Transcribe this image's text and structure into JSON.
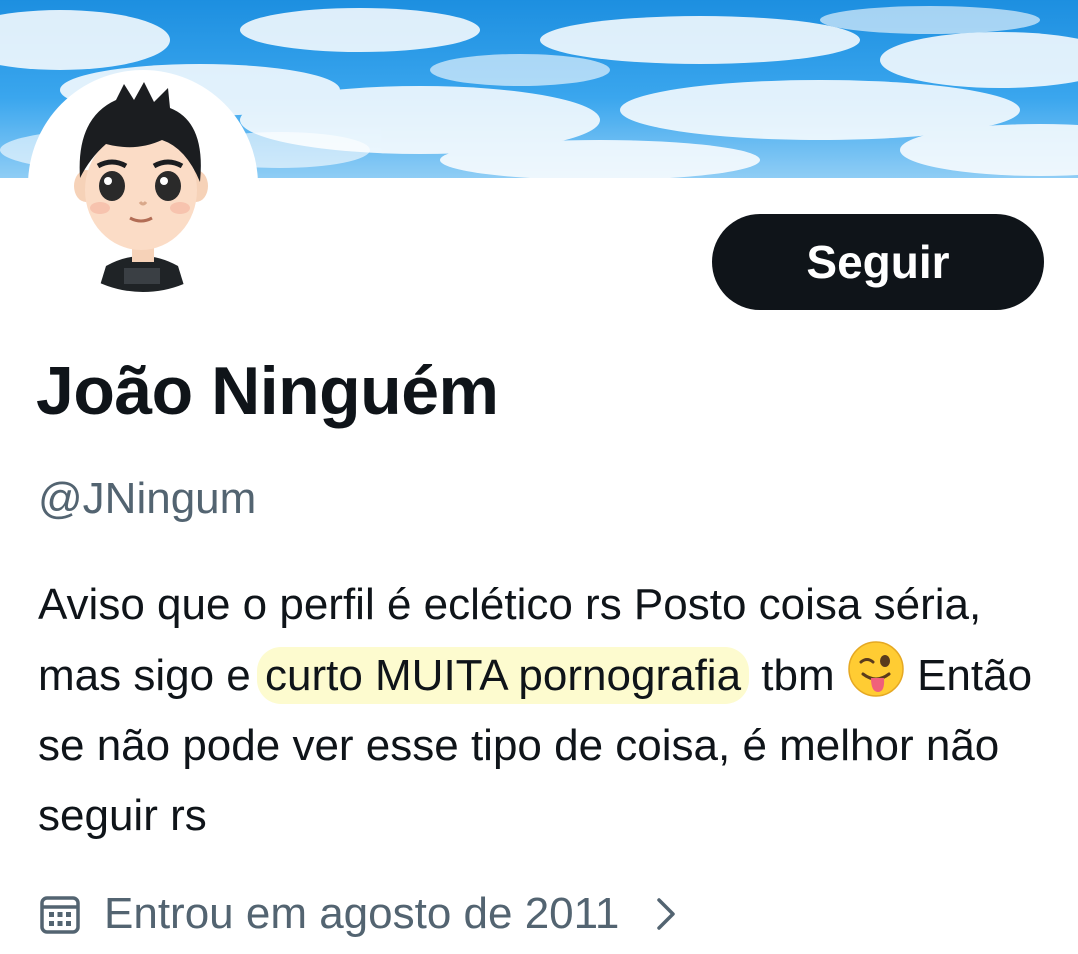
{
  "profile": {
    "follow_label": "Seguir",
    "display_name": "João Ninguém",
    "handle": "@JNingum",
    "bio": {
      "part1": "Aviso que o perfil é eclético rs Posto coisa séria, mas sigo e ",
      "highlight": "curto MUITA pornografia",
      "part2": " tbm ",
      "emoji": "winking-face-with-tongue",
      "part3": " Então se não pode ver esse tipo de coisa, é melhor não seguir rs"
    },
    "joined": "Entrou em agosto de 2011"
  },
  "colors": {
    "text_primary": "#0f1419",
    "text_secondary": "#536471",
    "button_bg": "#0f1419",
    "highlight": "#fdfbcf",
    "banner_sky": "#2f9be8"
  },
  "icons": {
    "joined": "calendar-icon",
    "joined_more": "chevron-right-icon"
  }
}
